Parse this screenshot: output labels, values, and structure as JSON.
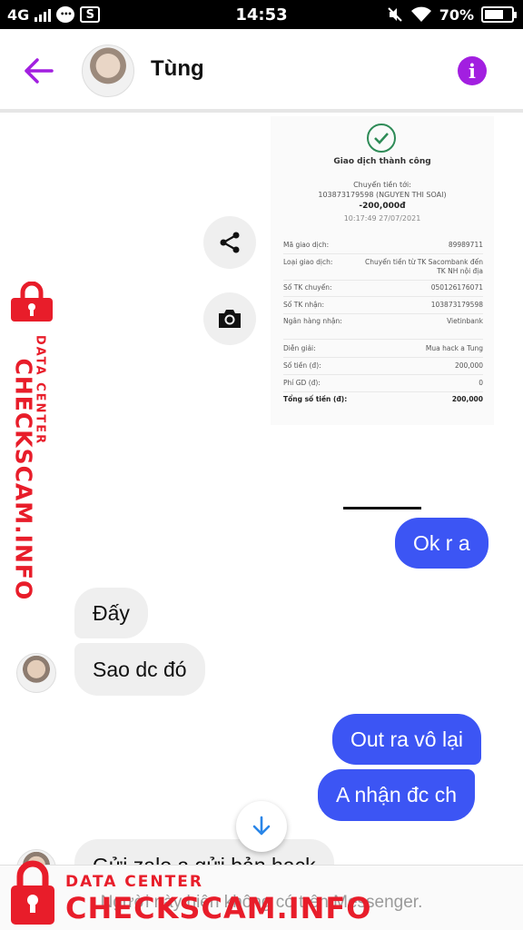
{
  "status_bar": {
    "network": "4G",
    "time": "14:53",
    "battery": "70%",
    "battery_level": 0.7,
    "icons": [
      "signal-icon",
      "chat-notification-icon",
      "sim-icon",
      "mute-icon",
      "wifi-icon",
      "battery-icon"
    ]
  },
  "header": {
    "contact_name": "Tùng",
    "back_icon": "arrow-left-icon",
    "info_icon": "info-icon",
    "accent_color": "#a21fe0"
  },
  "receipt": {
    "title": "Giao dịch thành công",
    "transfer_label": "Chuyển tiền tới:",
    "recipient": "103873179598 (NGUYEN THI SOAI)",
    "amount": "-200,000đ",
    "datetime": "10:17:49 27/07/2021",
    "rows": [
      {
        "label": "Mã giao dịch:",
        "value": "89989711"
      },
      {
        "label": "Loại giao dịch:",
        "value": "Chuyển tiền từ TK Sacombank đến TK NH nội địa"
      },
      {
        "label": "Số TK chuyển:",
        "value": "050126176071"
      },
      {
        "label": "Số TK nhận:",
        "value": "103873179598"
      },
      {
        "label": "Ngân hàng nhận:",
        "value": "Vietinbank"
      },
      {
        "label": "Diễn giải:",
        "value": "Mua hack a Tung"
      },
      {
        "label": "Số tiền (đ):",
        "value": "200,000"
      },
      {
        "label": "Phí GD (đ):",
        "value": "0"
      },
      {
        "label": "Tổng số tiền (đ):",
        "value": "200,000"
      }
    ]
  },
  "image_actions": {
    "share_icon": "share-icon",
    "save_icon": "camera-icon"
  },
  "messages": [
    {
      "from": "me",
      "text": "Ok r a"
    },
    {
      "from": "them",
      "text": "Đấy"
    },
    {
      "from": "them",
      "text": "Sao dc đó"
    },
    {
      "from": "me",
      "text": "Out ra vô lại"
    },
    {
      "from": "me",
      "text": "A nhận đc ch"
    },
    {
      "from": "them",
      "text": "Gửi zalo a gửi bản hack"
    }
  ],
  "colors": {
    "outgoing_bubble": "#3c55f4",
    "incoming_bubble": "#efefef",
    "watermark": "#e81d2a"
  },
  "footer": {
    "notice": "Người này hiện không có trên Messenger."
  },
  "watermark": {
    "line1": "DATA CENTER",
    "line2": "CHECKSCAM.INFO"
  }
}
